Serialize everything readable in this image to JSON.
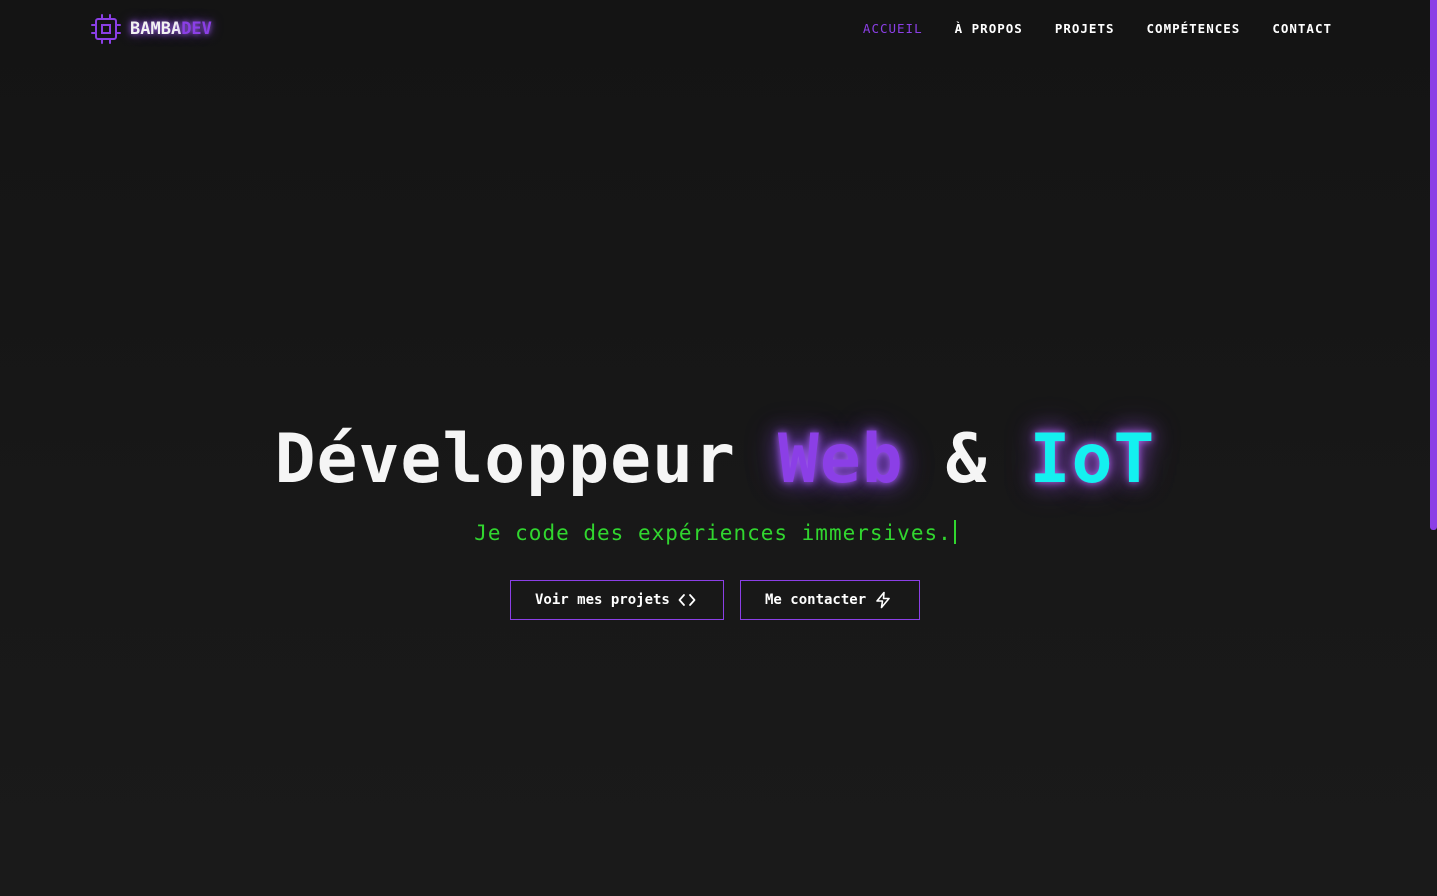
{
  "header": {
    "logo": {
      "icon": "cpu-chip-icon",
      "part1": "BAMBA",
      "part2": "DEV"
    },
    "nav": [
      {
        "label": "ACCUEIL",
        "active": true
      },
      {
        "label": "À PROPOS",
        "active": false
      },
      {
        "label": "PROJETS",
        "active": false
      },
      {
        "label": "COMPÉTENCES",
        "active": false
      },
      {
        "label": "CONTACT",
        "active": false
      }
    ]
  },
  "hero": {
    "title_part1": "Développeur ",
    "title_web": "Web",
    "title_amp": " & ",
    "title_iot": "IoT",
    "subtitle": "Je code des expériences immersives.",
    "buttons": {
      "projects_label": "Voir mes projets",
      "projects_icon": "code-brackets-icon",
      "contact_label": "Me contacter",
      "contact_icon": "lightning-bolt-icon"
    }
  },
  "colors": {
    "accent_purple": "#8b3fe6",
    "accent_cyan": "#14f0f0",
    "accent_green": "#31d62f",
    "background": "#161616",
    "text": "#ffffff"
  }
}
